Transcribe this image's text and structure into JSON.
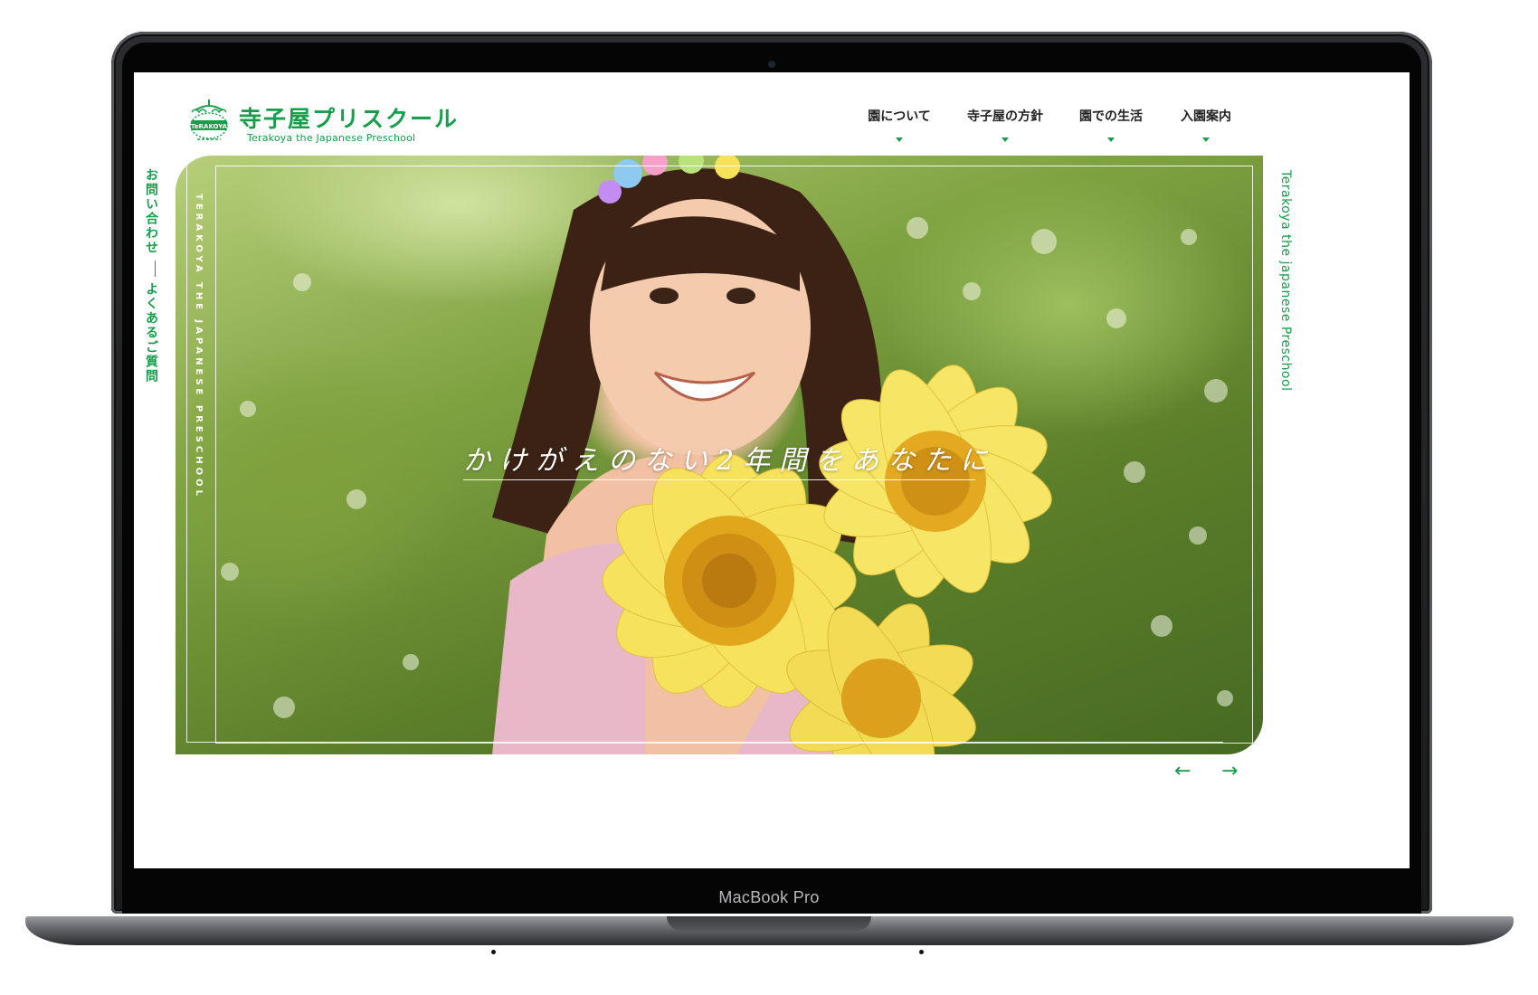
{
  "device": {
    "label": "MacBook Pro"
  },
  "brand": {
    "emblem_text": "TeRAKOYA",
    "title": "寺子屋プリスクール",
    "subtitle": "Terakoya the Japanese Preschool",
    "color": "#14a04a"
  },
  "nav": {
    "items": [
      {
        "label": "園について",
        "icon": "caret-down-icon"
      },
      {
        "label": "寺子屋の方針",
        "icon": "caret-down-icon"
      },
      {
        "label": "園での生活",
        "icon": "caret-down-icon"
      },
      {
        "label": "入園案内",
        "icon": "caret-down-icon"
      }
    ]
  },
  "side_left": {
    "contact": "お問い合わせ",
    "faq": "よくあるご質問"
  },
  "side_right": {
    "text": "Terakoya the japanese Preschool"
  },
  "hero": {
    "vertical_text": "TERAKOYA THE JAPANESE PRESCHOOL",
    "caption": "かけがえのない2年間をあなたに",
    "image": "smiling-girl-with-sunflowers-photo"
  },
  "slider": {
    "prev_icon": "arrow-left-icon",
    "next_icon": "arrow-right-icon",
    "prev": "←",
    "next": "→"
  }
}
